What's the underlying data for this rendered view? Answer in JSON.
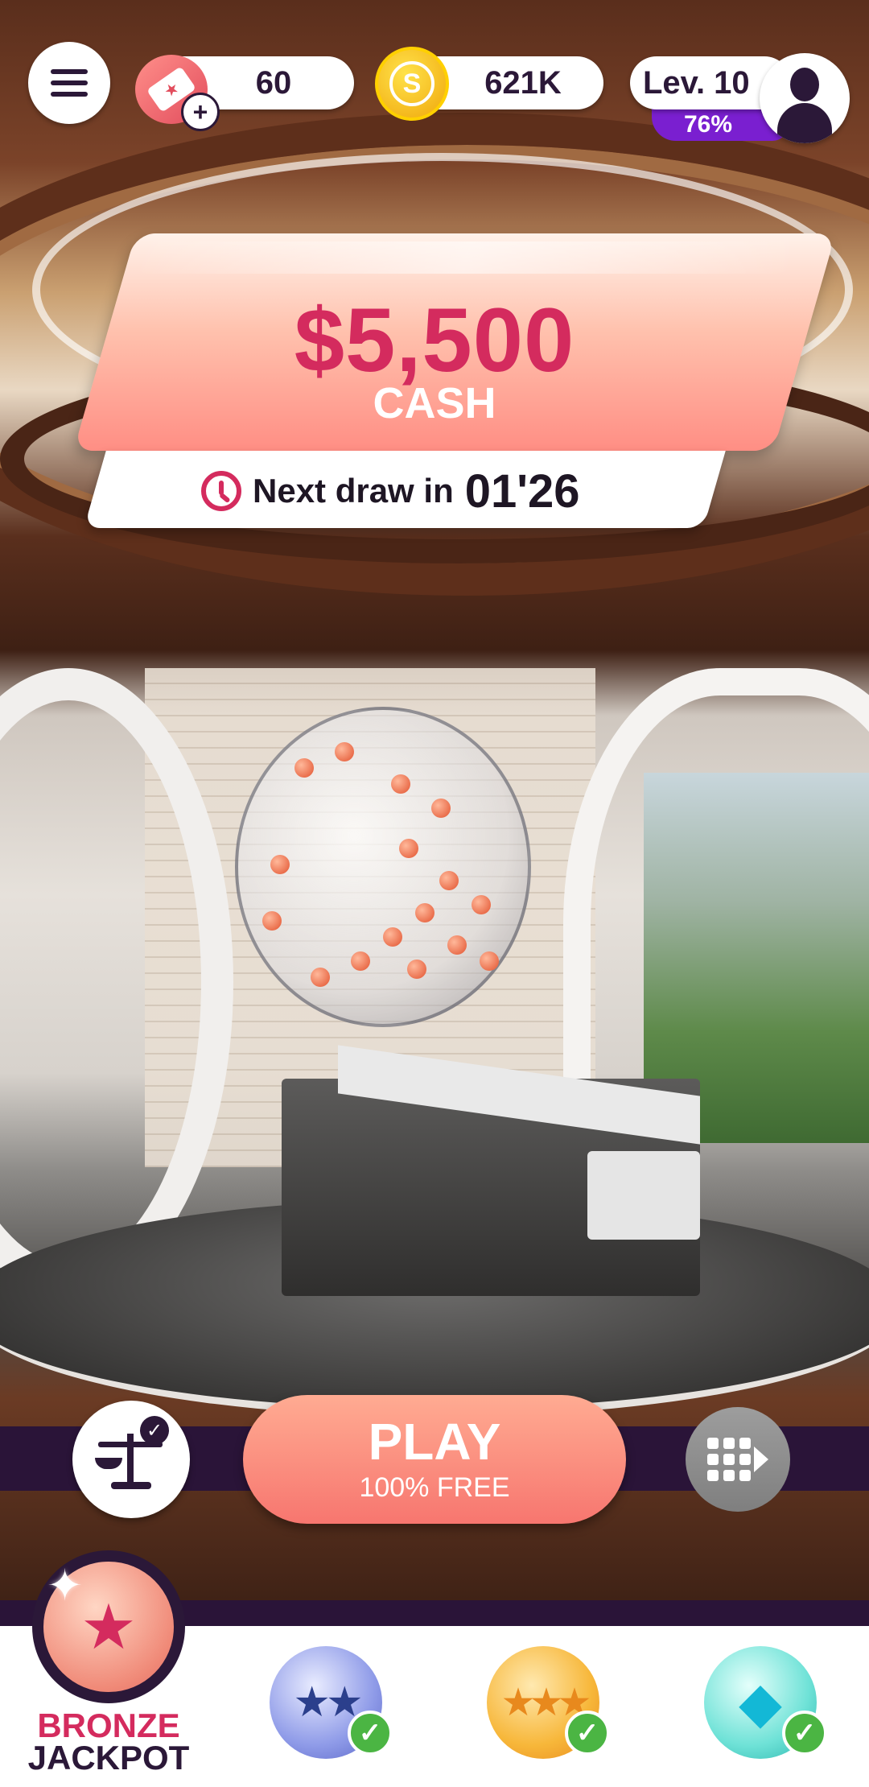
{
  "header": {
    "tickets": "60",
    "tickets_add": "+",
    "coins": "621K",
    "coin_symbol": "S",
    "level_label": "Lev. 10",
    "level_progress": "76%"
  },
  "jackpot": {
    "amount": "$5,500",
    "prize_type": "CASH",
    "next_draw_label": "Next draw in",
    "next_draw_time": "01'26"
  },
  "controls": {
    "play_label": "PLAY",
    "play_sub": "100% FREE"
  },
  "tabs": [
    {
      "label_line1": "BRONZE",
      "label_line2": "JACKPOT",
      "icon": "star-icon",
      "selected": true
    },
    {
      "icon": "two-stars-icon",
      "completed": true
    },
    {
      "icon": "three-stars-icon",
      "completed": true
    },
    {
      "icon": "diamond-icon",
      "completed": true
    }
  ],
  "colors": {
    "accent": "#d42b5e",
    "dark": "#2b1838",
    "level_bar": "#7a1fd0",
    "play_button": "#f7766f",
    "check_green": "#4bb543"
  }
}
